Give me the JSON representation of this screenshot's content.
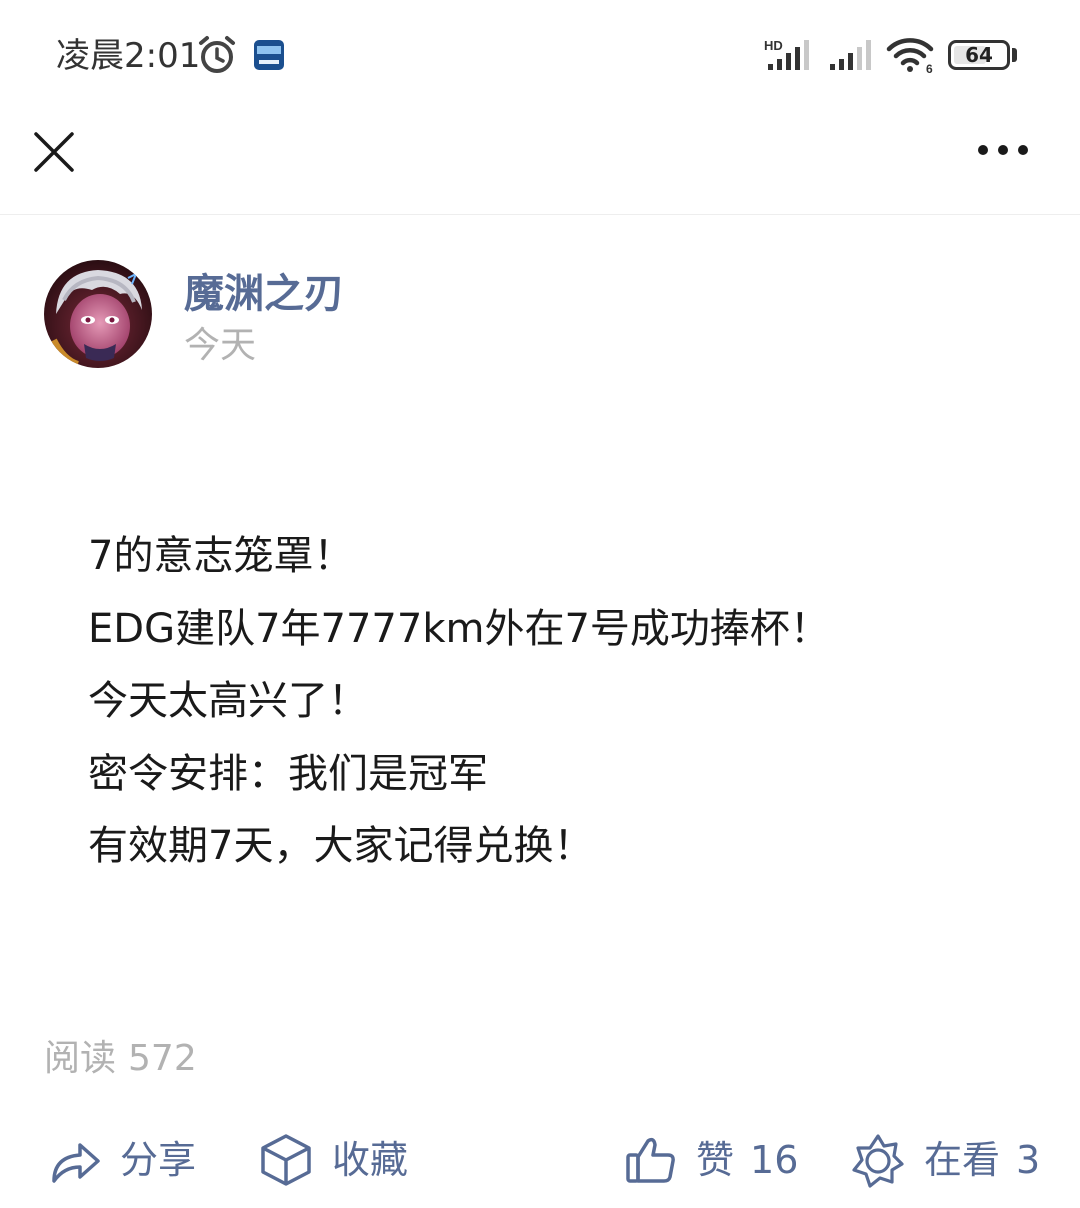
{
  "status_bar": {
    "time": "凌晨2:01",
    "network_label": "HD",
    "wifi_label": "6",
    "battery_level": 64,
    "battery_text": "64",
    "icons": [
      "alarm-icon",
      "app-notification-icon",
      "signal-hd-icon",
      "signal-icon",
      "wifi-icon",
      "battery-icon"
    ]
  },
  "header": {
    "close_icon": "close-icon",
    "more_icon": "more-icon"
  },
  "author": {
    "name": "魔渊之刃",
    "date": "今天",
    "avatar_icon": "avatar"
  },
  "post": {
    "lines": [
      "7的意志笼罩！",
      "EDG建队7年7777km外在7号成功捧杯！",
      "今天太高兴了！",
      "密令安排：我们是冠军",
      "有效期7天，大家记得兑换！"
    ]
  },
  "stats": {
    "read_label": "阅读",
    "read_count": "572"
  },
  "actions": {
    "share_label": "分享",
    "collect_label": "收藏",
    "like_label": "赞",
    "like_count": "16",
    "wow_label": "在看",
    "wow_count": "3",
    "accent_color": "#576b95"
  }
}
